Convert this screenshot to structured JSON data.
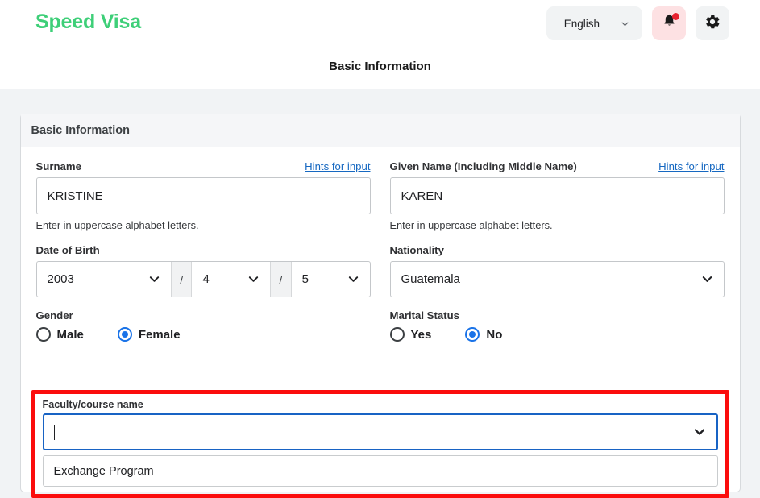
{
  "header": {
    "brand": "Speed Visa",
    "language": "English",
    "language_icon": "chevron-down-icon",
    "bell_icon": "notification-bell-icon",
    "gear_icon": "settings-gear-icon",
    "page_title": "Basic Information",
    "accent_green": "#3ecf78",
    "badge_color": "#e8212f",
    "bell_bg": "#fde1e3"
  },
  "card": {
    "title": "Basic Information"
  },
  "fields": {
    "surname": {
      "label": "Surname",
      "hint_link": "Hints for input",
      "value": "KRISTINE",
      "note": "Enter in uppercase alphabet letters."
    },
    "given_name": {
      "label": "Given Name",
      "label_extra": "(Including Middle Name)",
      "hint_link": "Hints for input",
      "value": "KAREN",
      "note": "Enter in uppercase alphabet letters."
    },
    "date_of_birth": {
      "label": "Date of Birth",
      "year": "2003",
      "month": "4",
      "day": "5",
      "separator": "/"
    },
    "nationality": {
      "label": "Nationality",
      "value": "Guatemala"
    },
    "gender": {
      "label": "Gender",
      "options": [
        {
          "label": "Male",
          "checked": false
        },
        {
          "label": "Female",
          "checked": true
        }
      ]
    },
    "marital_status": {
      "label": "Marital Status",
      "options": [
        {
          "label": "Yes",
          "checked": false
        },
        {
          "label": "No",
          "checked": true
        }
      ]
    },
    "faculty_course": {
      "label": "Faculty/course name",
      "value": "",
      "suggestions": [
        "Exchange Program"
      ],
      "highlight_color": "#fb0d0d",
      "focus_border_color": "#1863c4"
    }
  }
}
